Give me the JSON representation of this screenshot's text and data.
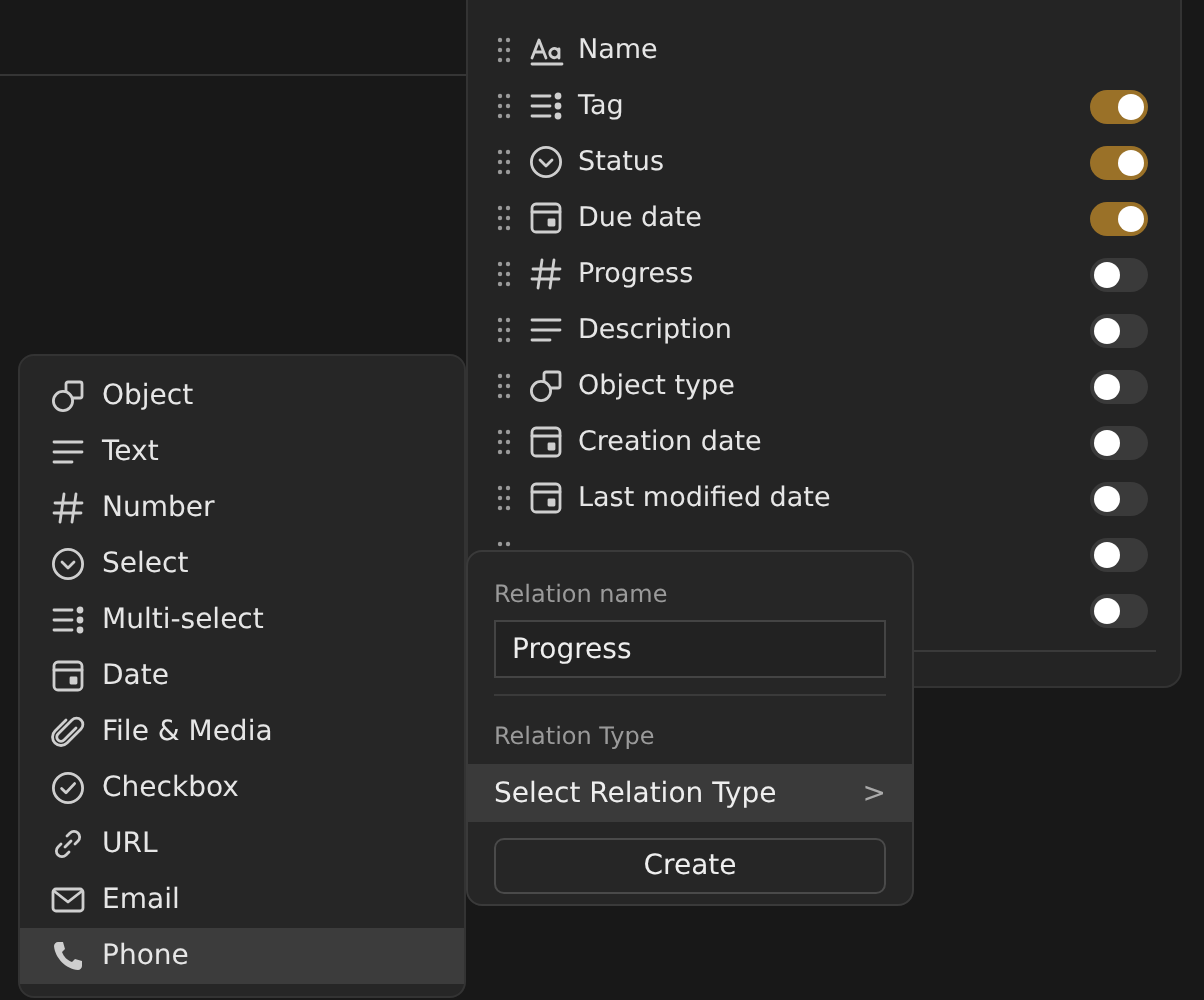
{
  "properties": [
    {
      "label": "Name",
      "kind": "name"
    },
    {
      "label": "Tag",
      "kind": "multiselect",
      "on": true
    },
    {
      "label": "Status",
      "kind": "select",
      "on": true
    },
    {
      "label": "Due date",
      "kind": "date",
      "on": true
    },
    {
      "label": "Progress",
      "kind": "number",
      "on": false
    },
    {
      "label": "Description",
      "kind": "text",
      "on": false
    },
    {
      "label": "Object type",
      "kind": "object",
      "on": false
    },
    {
      "label": "Creation date",
      "kind": "date",
      "on": false
    },
    {
      "label": "Last modified date",
      "kind": "date",
      "on": false
    },
    {
      "kind": "hidden",
      "on": false
    },
    {
      "kind": "covered",
      "on": false
    }
  ],
  "type_menu": [
    {
      "label": "Object",
      "kind": "object",
      "selected": false
    },
    {
      "label": "Text",
      "kind": "text",
      "selected": false
    },
    {
      "label": "Number",
      "kind": "number",
      "selected": false
    },
    {
      "label": "Select",
      "kind": "select",
      "selected": false
    },
    {
      "label": "Multi-select",
      "kind": "multiselect",
      "selected": false
    },
    {
      "label": "Date",
      "kind": "date",
      "selected": false
    },
    {
      "label": "File & Media",
      "kind": "file",
      "selected": false
    },
    {
      "label": "Checkbox",
      "kind": "checkbox",
      "selected": false
    },
    {
      "label": "URL",
      "kind": "url",
      "selected": false
    },
    {
      "label": "Email",
      "kind": "email",
      "selected": false
    },
    {
      "label": "Phone",
      "kind": "phone",
      "selected": true
    }
  ],
  "relation_form": {
    "name_label": "Relation name",
    "name_value": "Progress",
    "type_label": "Relation Type",
    "type_select": "Select Relation Type",
    "type_chevron": ">",
    "create_button": "Create"
  }
}
